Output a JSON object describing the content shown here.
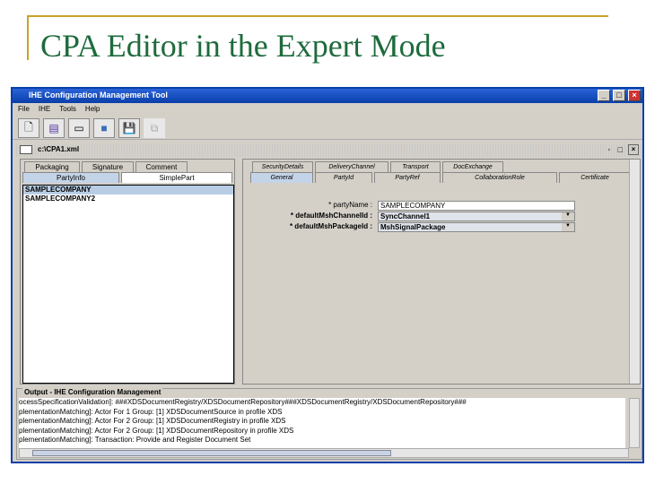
{
  "slide": {
    "title": "CPA Editor in the Expert Mode"
  },
  "window": {
    "title": "IHE Configuration Management Tool"
  },
  "menu": [
    "File",
    "IHE",
    "Tools",
    "Help"
  ],
  "toolbar": [
    "new-doc-icon",
    "edit-doc-icon",
    "card-icon",
    "open-folder-icon",
    "save-icon",
    "copy-icon"
  ],
  "document": {
    "title": "c:\\CPA1.xml"
  },
  "left": {
    "tabs_row1": [
      "Packaging",
      "Signature",
      "Comment"
    ],
    "tabs_row2": [
      "PartyInfo",
      "SimplePart"
    ],
    "items": [
      "SAMPLECOMPANY",
      "SAMPLECOMPANY2"
    ]
  },
  "right": {
    "tabs_row1": [
      "SecurityDetails",
      "DeliveryChannel",
      "Transport",
      "DocExchange"
    ],
    "tabs_row2": [
      "General",
      "PartyId",
      "PartyRef",
      "CollaborationRole",
      "Certificate"
    ],
    "fields": [
      {
        "label": "* partyName :",
        "value": "SAMPLECOMPANY"
      },
      {
        "label": "* defaultMshChannelId :",
        "value": "SyncChannel1"
      },
      {
        "label": "* defaultMshPackageId :",
        "value": "MshSignalPackage"
      }
    ]
  },
  "output": {
    "title": "Output - IHE Configuration Management",
    "lines": [
      "ocessSpecificationValidation]: ###XDSDocumentRegistry/XDSDocumentRepository###XDSDocumentRegistry/XDSDocumentRepository###",
      "plementationMatching]: Actor For 1 Group: [1] XDSDocumentSource in profile XDS",
      "plementationMatching]: Actor For 2 Group: [1] XDSDocumentRegistry in profile XDS",
      "plementationMatching]: Actor For 2 Group: [1] XDSDocumentRepository in profile XDS",
      "plementationMatching]: Transaction: Provide and Register Document Set"
    ]
  }
}
